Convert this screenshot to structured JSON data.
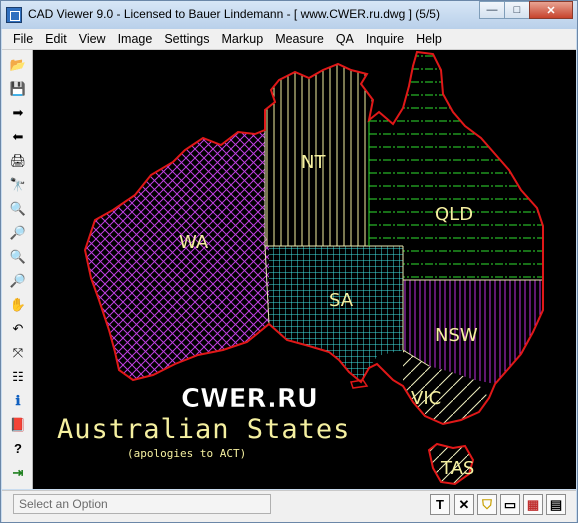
{
  "window": {
    "title": "CAD Viewer 9.0 - Licensed to Bauer Lindemann  -  [ www.CWER.ru.dwg ] (5/5)",
    "minimize_glyph": "—",
    "maximize_glyph": "□",
    "close_glyph": "✕"
  },
  "menu": {
    "items": [
      "File",
      "Edit",
      "View",
      "Image",
      "Settings",
      "Markup",
      "Measure",
      "QA",
      "Inquire",
      "Help"
    ]
  },
  "toolbar": {
    "tools": [
      {
        "name": "open-folder-icon",
        "glyph": "📂"
      },
      {
        "name": "save-disk-icon",
        "glyph": "💾"
      },
      {
        "name": "forward-arrow-icon",
        "glyph": "➡"
      },
      {
        "name": "back-arrow-icon",
        "glyph": "⬅"
      },
      {
        "name": "print-icon",
        "glyph": "🖨"
      },
      {
        "name": "binoculars-icon",
        "glyph": "🔭"
      },
      {
        "name": "zoom-icon",
        "glyph": "🔍"
      },
      {
        "name": "zoom-in-icon",
        "glyph": "🔎"
      },
      {
        "name": "zoom-out-icon",
        "glyph": "🔍"
      },
      {
        "name": "zoom-window-icon",
        "glyph": "🔎"
      },
      {
        "name": "pan-hand-icon",
        "glyph": "✋"
      },
      {
        "name": "undo-icon",
        "glyph": "↶"
      },
      {
        "name": "axes-icon",
        "glyph": "⤧"
      },
      {
        "name": "layers-icon",
        "glyph": "☷"
      },
      {
        "name": "info-icon",
        "glyph": "ℹ"
      },
      {
        "name": "book-icon",
        "glyph": "📕"
      },
      {
        "name": "help-question-icon",
        "glyph": "?"
      },
      {
        "name": "exit-icon",
        "glyph": "⇥"
      }
    ]
  },
  "drawing": {
    "states": {
      "wa": "WA",
      "nt": "NT",
      "qld": "QLD",
      "sa": "SA",
      "nsw": "NSW",
      "vic": "VIC",
      "tas": "TAS"
    },
    "heading": "Australian States",
    "subheading": "(apologies to ACT)",
    "watermark": "CWER.RU"
  },
  "status": {
    "prompt": "Select an Option",
    "buttons": [
      {
        "name": "text-tool-button",
        "glyph": "T"
      },
      {
        "name": "cancel-button",
        "glyph": "✕"
      },
      {
        "name": "shield-icon-button",
        "glyph": "⛉"
      },
      {
        "name": "window-view-button",
        "glyph": "▭"
      },
      {
        "name": "color-grid-button",
        "glyph": "▦"
      },
      {
        "name": "layout-button",
        "glyph": "▤"
      }
    ]
  },
  "colors": {
    "outline": "#e01818",
    "wa": "#c040e0",
    "nt": "#f5f0a0",
    "qld": "#30e030",
    "sa": "#40e0e0",
    "nsw": "#c030e0",
    "vic": "#f0f0c0",
    "tas": "#f0f0c0",
    "text": "#f5f0a0"
  }
}
